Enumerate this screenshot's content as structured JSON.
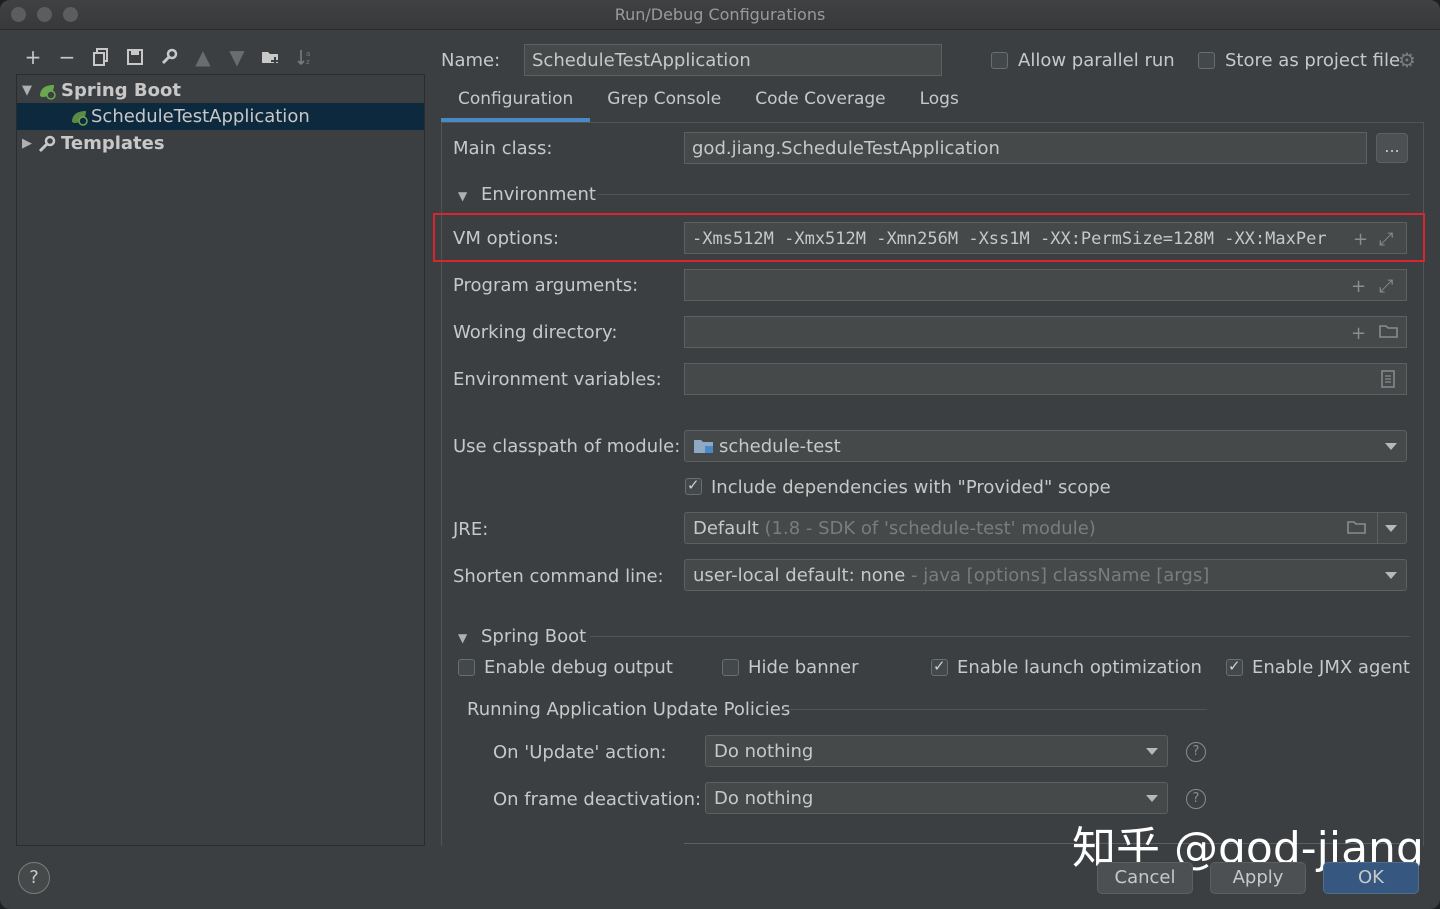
{
  "window": {
    "title": "Run/Debug Configurations"
  },
  "tree": {
    "spring_boot": "Spring Boot",
    "app": "ScheduleTestApplication",
    "templates": "Templates"
  },
  "header": {
    "name_label": "Name:",
    "name_value": "ScheduleTestApplication",
    "allow_parallel": "Allow parallel run",
    "store_project": "Store as project file"
  },
  "tabs": [
    "Configuration",
    "Grep Console",
    "Code Coverage",
    "Logs"
  ],
  "config": {
    "main_class_label": "Main class:",
    "main_class_value": "god.jiang.ScheduleTestApplication",
    "browse": "...",
    "environment": "Environment",
    "vm_label": "VM options:",
    "vm_value": "-Xms512M -Xmx512M -Xmn256M -Xss1M -XX:PermSize=128M -XX:MaxPer",
    "program_args_label": "Program arguments:",
    "working_dir_label": "Working directory:",
    "env_vars_label": "Environment variables:",
    "classpath_label": "Use classpath of module:",
    "classpath_value": "schedule-test",
    "include_deps": "Include dependencies with \"Provided\" scope",
    "jre_label": "JRE:",
    "jre_value": "Default",
    "jre_hint": "(1.8 - SDK of 'schedule-test' module)",
    "shorten_label": "Shorten command line:",
    "shorten_value": "user-local default: none",
    "shorten_hint": "- java [options] className [args]"
  },
  "spring_boot": {
    "section": "Spring Boot",
    "debug_output": "Enable debug output",
    "hide_banner": "Hide banner",
    "launch_opt": "Enable launch optimization",
    "jmx_agent": "Enable JMX agent",
    "policies": "Running Application Update Policies",
    "update_label": "On 'Update' action:",
    "update_value": "Do nothing",
    "frame_label": "On frame deactivation:",
    "frame_value": "Do nothing"
  },
  "footer": {
    "help": "?",
    "cancel": "Cancel",
    "apply": "Apply",
    "ok": "OK",
    "watermark": "知乎 @god-jiang"
  }
}
